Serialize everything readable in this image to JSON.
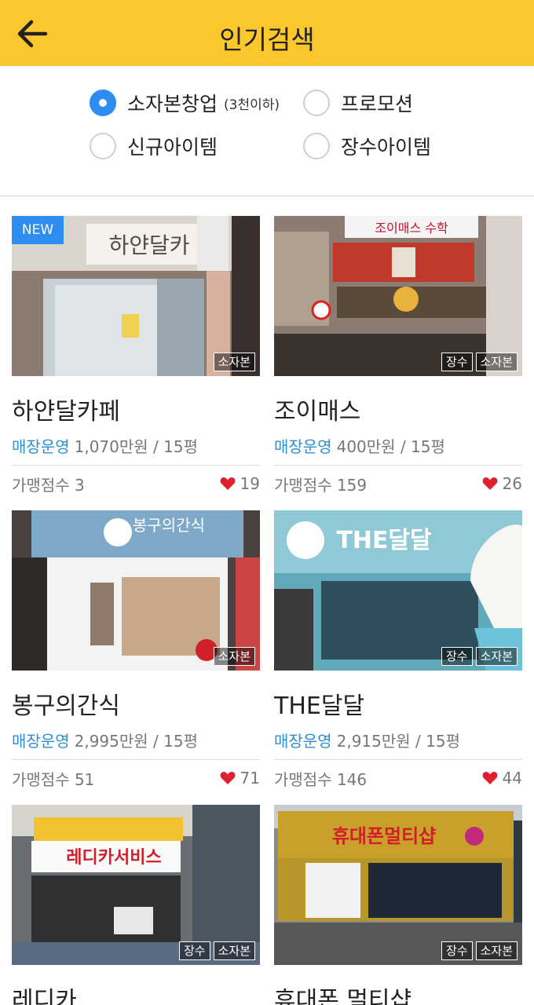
{
  "header": {
    "title": "인기검색",
    "back_icon": "arrow-left-icon"
  },
  "filters": [
    {
      "label": "소자본창업",
      "sub": "(3천이하)",
      "checked": true
    },
    {
      "label": "프로모션",
      "checked": false
    },
    {
      "label": "신규아이템",
      "checked": false
    },
    {
      "label": "장수아이템",
      "checked": false
    }
  ],
  "items": [
    {
      "badge": "NEW",
      "tags": [
        "소자본"
      ],
      "title": "하얀달카페",
      "op_label": "매장운영",
      "price": "1,070만원 / 15평",
      "score": "가맹점수 3",
      "likes": "19",
      "sign": "하얀달카"
    },
    {
      "badge": "",
      "tags": [
        "장수",
        "소자본"
      ],
      "title": "조이매스",
      "op_label": "매장운영",
      "price": "400만원 / 15평",
      "score": "가맹점수 159",
      "likes": "26",
      "sign": "조이매스 수학"
    },
    {
      "badge": "",
      "tags": [
        "소자본"
      ],
      "title": "봉구의간식",
      "op_label": "매장운영",
      "price": "2,995만원 / 15평",
      "score": "가맹점수 51",
      "likes": "71",
      "sign": "봉구의간식"
    },
    {
      "badge": "",
      "tags": [
        "장수",
        "소자본"
      ],
      "title": "THE달달",
      "op_label": "매장운영",
      "price": "2,915만원 / 15평",
      "score": "가맹점수 146",
      "likes": "44",
      "sign": "THE달달"
    },
    {
      "badge": "",
      "tags": [
        "장수",
        "소자본"
      ],
      "title": "레디카",
      "sign": "레디카서비스"
    },
    {
      "badge": "",
      "tags": [
        "장수",
        "소자본"
      ],
      "title": "휴대폰 멀티샵",
      "sign": "휴대폰멀티샵"
    }
  ],
  "colors": {
    "header": "#fcc72c",
    "accent": "#2d8df0",
    "op_label": "#2d8fd3",
    "heart": "#e0202e"
  }
}
